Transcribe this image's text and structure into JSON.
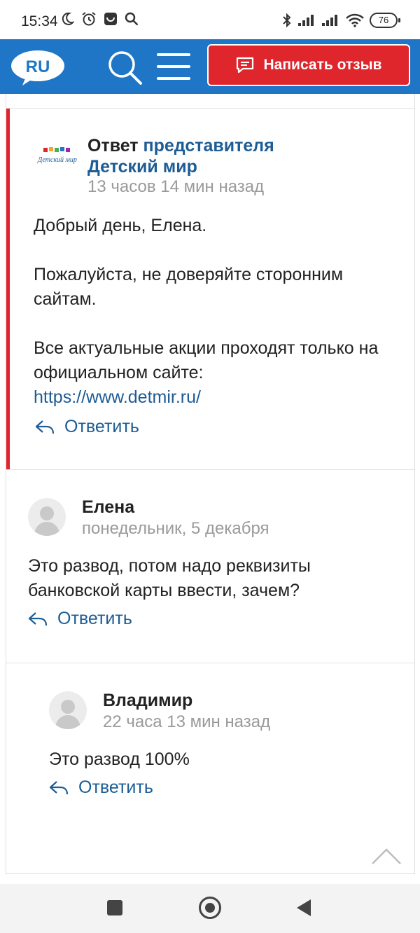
{
  "status_bar": {
    "time": "15:34",
    "battery": "76",
    "icons": [
      "moon-icon",
      "alarm-icon",
      "notification-icon",
      "search-icon",
      "bluetooth-icon",
      "signal-icon",
      "signal-icon",
      "wifi-icon"
    ]
  },
  "header": {
    "logo_text": "RU",
    "review_button": "Написать отзыв",
    "colors": {
      "bar": "#1f76c6",
      "button": "#e0262d"
    }
  },
  "rep_answer": {
    "prefix": "Ответ",
    "link": "представителя Детский мир",
    "logo_caption": "Детский мир",
    "time": "13 часов 14 мин назад",
    "body": {
      "p1": "Добрый день, Елена.",
      "p2": "Пожалуйста, не доверяйте сторонним сайтам.",
      "p3": "Все актуальные акции проходят только на официальном сайте:",
      "url": "https://www.detmir.ru/"
    },
    "reply_label": "Ответить"
  },
  "comments": [
    {
      "name": "Елена",
      "time": "понедельник, 5 декабря",
      "text": "Это развод, потом надо реквизиты банковской карты ввести, зачем?",
      "reply_label": "Ответить"
    },
    {
      "name": "Владимир",
      "time": "22 часа 13 мин назад",
      "text": "Это развод 100%",
      "reply_label": "Ответить"
    }
  ]
}
